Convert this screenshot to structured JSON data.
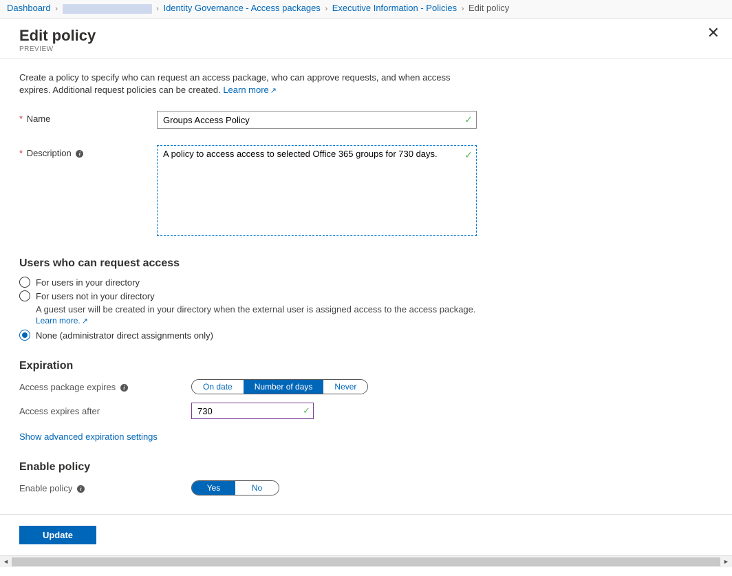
{
  "breadcrumb": {
    "dashboard": "Dashboard",
    "identity_gov": "Identity Governance - Access packages",
    "exec_info": "Executive Information - Policies",
    "current": "Edit policy"
  },
  "header": {
    "title": "Edit policy",
    "preview": "PREVIEW"
  },
  "intro": {
    "text": "Create a policy to specify who can request an access package, who can approve requests, and when access expires. Additional request policies can be created.",
    "learn_more": "Learn more"
  },
  "form": {
    "name_label": "Name",
    "name_value": "Groups Access Policy",
    "desc_label": "Description",
    "desc_value": "A policy to access access to selected Office 365 groups for 730 days."
  },
  "users_section": {
    "heading": "Users who can request access",
    "opt1": "For users in your directory",
    "opt2": "For users not in your directory",
    "opt2_helper": "A guest user will be created in your directory when the external user is assigned access to the access package.",
    "opt2_learn": "Learn more.",
    "opt3": "None (administrator direct assignments only)"
  },
  "expiration": {
    "heading": "Expiration",
    "expires_label": "Access package expires",
    "pill_date": "On date",
    "pill_days": "Number of days",
    "pill_never": "Never",
    "after_label": "Access expires after",
    "after_value": "730",
    "advanced_link": "Show advanced expiration settings"
  },
  "enable": {
    "heading": "Enable policy",
    "label": "Enable policy",
    "yes": "Yes",
    "no": "No"
  },
  "footer": {
    "update": "Update"
  }
}
